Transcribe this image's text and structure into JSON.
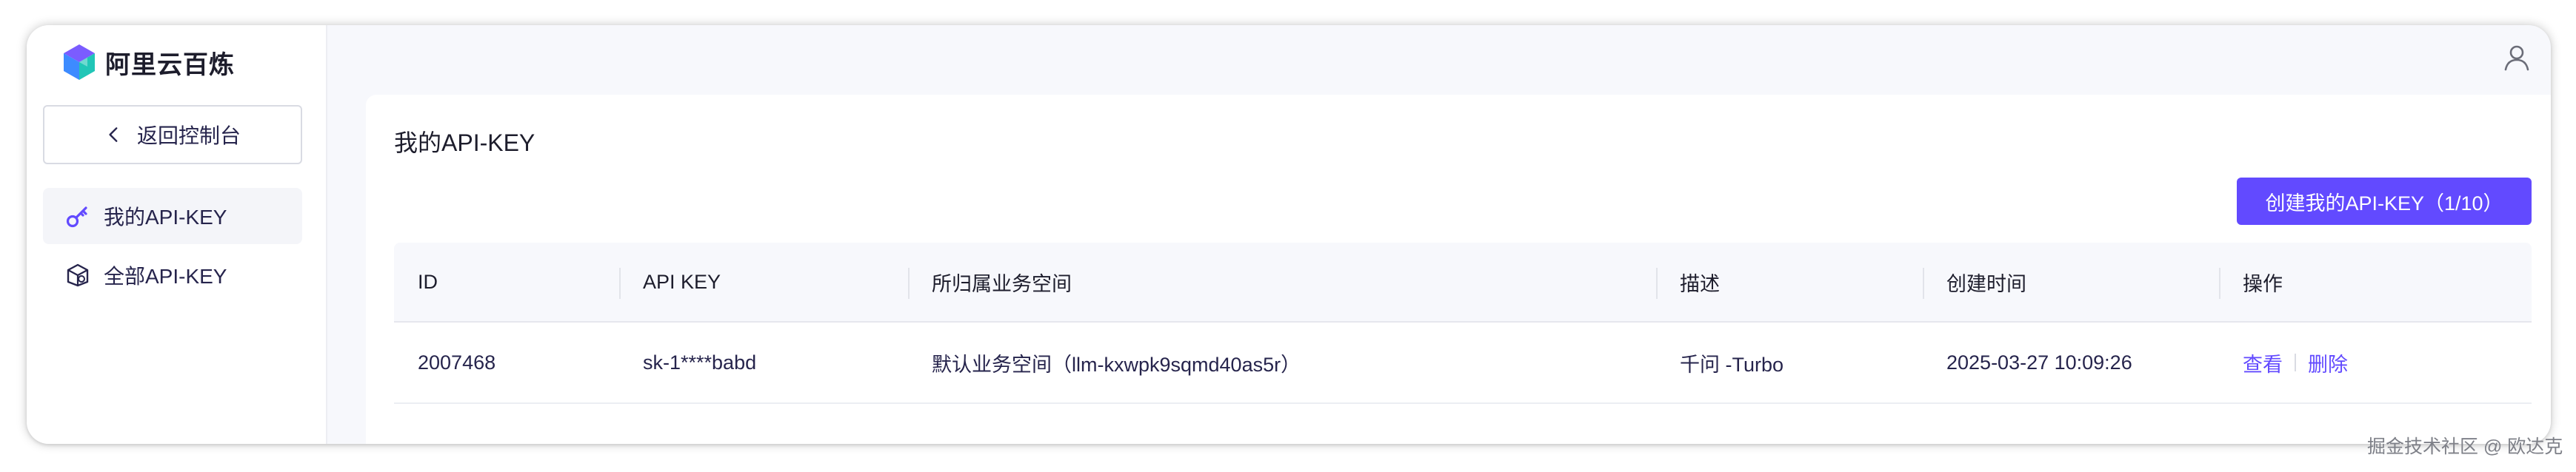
{
  "app": {
    "name": "阿里云百炼"
  },
  "sidebar": {
    "back_label": "返回控制台",
    "items": [
      {
        "label": "我的API-KEY",
        "icon": "key-icon",
        "active": true
      },
      {
        "label": "全部API-KEY",
        "icon": "cube-icon",
        "active": false
      }
    ]
  },
  "main": {
    "title": "我的API-KEY",
    "create_button": "创建我的API-KEY（1/10）",
    "table": {
      "headers": [
        "ID",
        "API KEY",
        "所归属业务空间",
        "描述",
        "创建时间",
        "操作"
      ],
      "rows": [
        {
          "id": "2007468",
          "api_key": "sk-1****babd",
          "workspace": "默认业务空间（llm-kxwpk9sqmd40as5r）",
          "description": "千问 -Turbo",
          "created": "2025-03-27 10:09:26",
          "actions": {
            "view": "查看",
            "delete": "删除"
          }
        }
      ]
    }
  },
  "watermark": "掘金技术社区 @ 欧达克",
  "colors": {
    "accent": "#624aff",
    "sidebar_active": "#f4f5f9",
    "header_bg": "#f7f8fc"
  }
}
